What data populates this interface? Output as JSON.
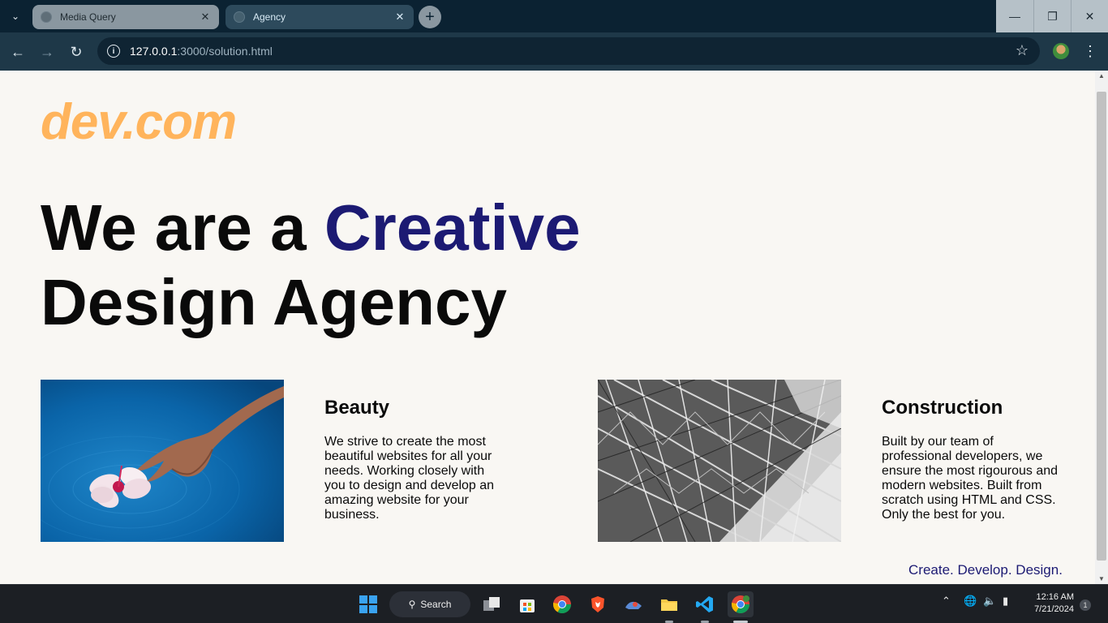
{
  "browser": {
    "tabs": [
      {
        "title": "Media Query",
        "active": false
      },
      {
        "title": "Agency",
        "active": true
      }
    ],
    "url_host": "127.0.0.1",
    "url_path": ":3000/solution.html",
    "new_tab_label": "+"
  },
  "page": {
    "logo": "dev.com",
    "hero_line1_start": "We are a ",
    "hero_line1_accent": "Creative",
    "hero_line2": "Design Agency",
    "cards": [
      {
        "title": "Beauty",
        "text": "We strive to create the most beautiful websites for all your needs. Working closely with you to design and develop an amazing website for your business."
      },
      {
        "title": "Construction",
        "text": "Built by our team of professional developers, we ensure the most rigourous and modern websites. Built from scratch using HTML and CSS. Only the best for you."
      }
    ],
    "tagline": "Create. Develop. Design."
  },
  "taskbar": {
    "search_label": "Search",
    "time": "12:16 AM",
    "date": "7/21/2024",
    "notification_count": "1"
  },
  "colors": {
    "logo": "#ffb45c",
    "accent": "#1c1a73",
    "page_bg": "#f9f7f3"
  }
}
